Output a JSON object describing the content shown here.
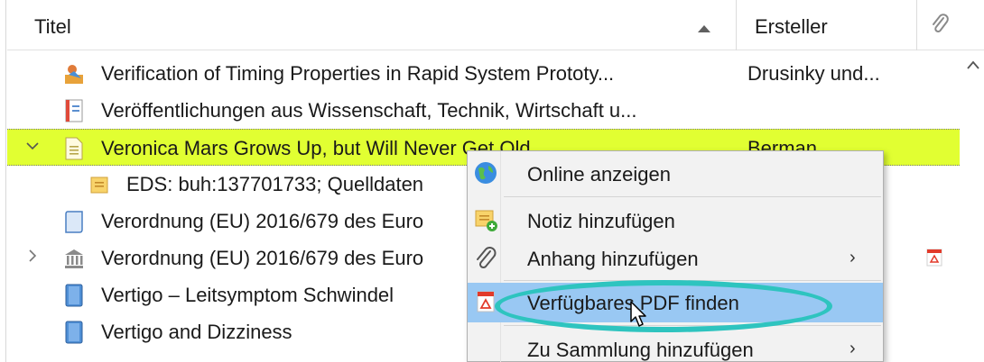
{
  "columns": {
    "title": "Titel",
    "creator": "Ersteller",
    "attachment_icon": "paperclip-icon"
  },
  "rows": [
    {
      "title": "Verification of Timing Properties in Rapid System Prototy...",
      "creator": "Drusinky und...",
      "icon": "presentation-icon"
    },
    {
      "title": "Veröffentlichungen aus Wissenschaft, Technik, Wirtschaft u...",
      "creator": "",
      "icon": "journal-icon"
    },
    {
      "title": "Veronica Mars Grows Up, but Will Never Get Old",
      "creator": "Berman",
      "icon": "document-icon",
      "selected": true,
      "expanded": true
    },
    {
      "title": "EDS: buh:137701733; Quelldaten",
      "creator": "",
      "icon": "note-icon",
      "child": true
    },
    {
      "title": "Verordnung (EU) 2016/679 des Euro",
      "creator": "",
      "icon": "manuscript-icon"
    },
    {
      "title": "Verordnung (EU) 2016/679 des Euro",
      "creator": "",
      "icon": "statute-icon",
      "collapsed": true,
      "attachment": "pdf-icon"
    },
    {
      "title": "Vertigo – Leitsymptom Schwindel",
      "creator": "",
      "icon": "book-icon"
    },
    {
      "title": "Vertigo and Dizziness",
      "creator": "",
      "icon": "book-icon"
    }
  ],
  "context_menu": {
    "items": [
      {
        "label": "Online anzeigen",
        "icon": "globe-icon"
      },
      {
        "label": "Notiz hinzufügen",
        "icon": "add-note-icon"
      },
      {
        "label": "Anhang hinzufügen",
        "icon": "paperclip-icon",
        "submenu": true
      },
      {
        "label": "Verfügbares PDF finden",
        "icon": "pdf-icon",
        "highlighted": true
      },
      {
        "label": "Zu Sammlung hinzufügen",
        "icon": "",
        "submenu": true
      }
    ],
    "submenu_arrow": "›"
  },
  "colors": {
    "selected_row": "#e1ff32",
    "menu_hover": "#99c8f3",
    "annotation_ellipse": "#2ec4bf"
  }
}
